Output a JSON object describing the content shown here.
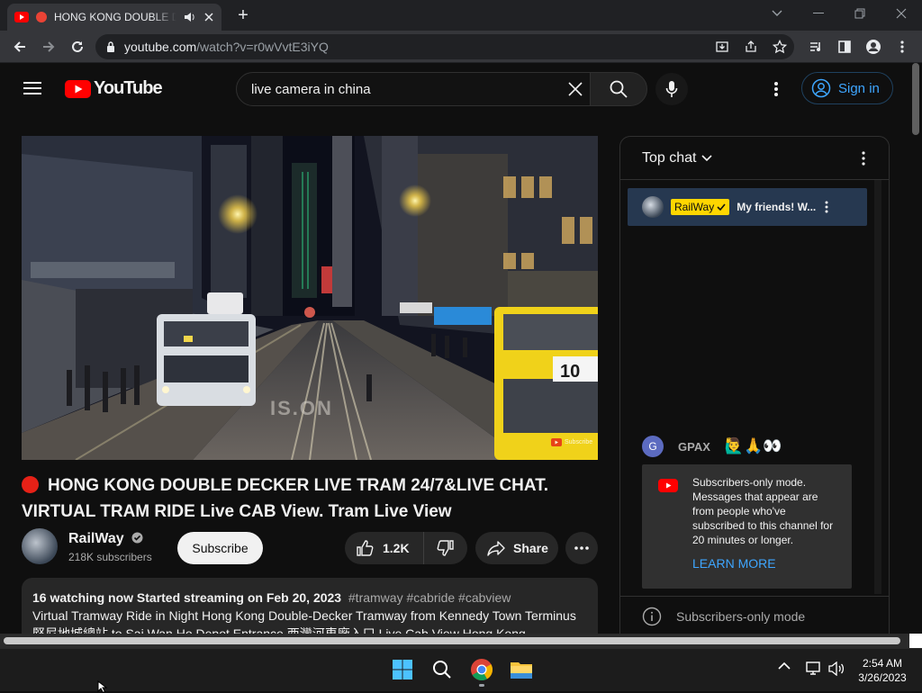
{
  "browser": {
    "tab_title": "HONG KONG DOUBLE DECKER LIVE TRAM",
    "url_host": "youtube.com",
    "url_path": "/watch?v=r0wVvtE3iYQ"
  },
  "masthead": {
    "logo_text": "YouTube",
    "search_value": "live camera in china",
    "signin_label": "Sign in"
  },
  "video": {
    "overlay_text": "IS.ON",
    "watermark": "Subscribe",
    "title": "HONG KONG DOUBLE DECKER LIVE TRAM 24/7&LIVE CHAT. VIRTUAL TRAM RIDE Live CAB View. Tram Live View"
  },
  "channel": {
    "name": "RailWay",
    "subscribers": "218K subscribers",
    "subscribe_label": "Subscribe"
  },
  "actions": {
    "likes": "1.2K",
    "share_label": "Share"
  },
  "description": {
    "meta": "16 watching now  Started streaming on Feb 20, 2023",
    "tags": "#tramway #cabride #cabview",
    "text": "Virtual Tramway Ride in Night Hong Kong Double-Decker Tramway from Kennedy Town Terminus 堅尼地城總站 to Sai Wan Ho Depot Entrance 西灣河車廠入口 Live Cab View Hong Kong"
  },
  "chat": {
    "header": "Top chat",
    "pinned_author": "RailWay",
    "pinned_message": "My friends! W...",
    "message_author": "GPAX",
    "message_initial": "G",
    "message_text": "🙋‍♂️🙏👀",
    "submode_text": "Subscribers-only mode. Messages that appear are from people who've subscribed to this channel for 20 minutes or longer.",
    "learn_more": "LEARN MORE",
    "footer": "Subscribers-only mode"
  },
  "taskbar": {
    "time": "2:54 AM",
    "date": "3/26/2023"
  },
  "colors": {
    "yt_red": "#ff0000",
    "link_blue": "#3ea6ff",
    "badge_yellow": "#ffd600"
  }
}
